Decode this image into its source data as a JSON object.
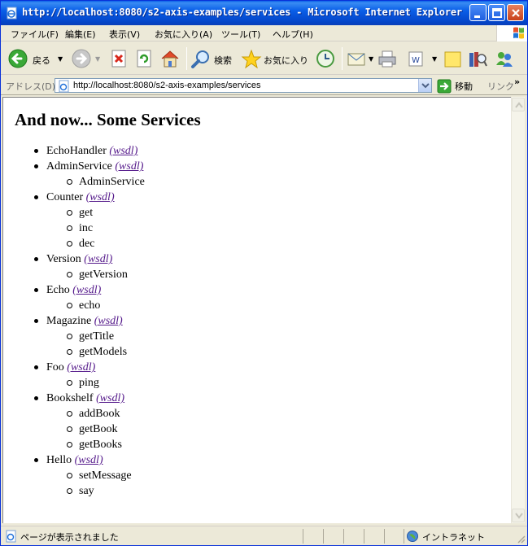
{
  "window": {
    "title": "http://localhost:8080/s2-axis-examples/services - Microsoft Internet Explorer"
  },
  "menu": [
    "ファイル(F)",
    "編集(E)",
    "表示(V)",
    "お気に入り(A)",
    "ツール(T)",
    "ヘルプ(H)"
  ],
  "toolbar": {
    "back_label": "戻る",
    "search_label": "検索",
    "favorites_label": "お気に入り"
  },
  "address": {
    "label": "アドレス(D)",
    "url": "http://localhost:8080/s2-axis-examples/services",
    "go_label": "移動",
    "links_label": "リンク"
  },
  "page": {
    "title": "And now... Some Services",
    "services": [
      {
        "name": "EchoHandler",
        "link": "(wsdl)",
        "ops": []
      },
      {
        "name": "AdminService",
        "link": "(wsdl)",
        "ops": [
          "AdminService"
        ]
      },
      {
        "name": "Counter",
        "link": "(wsdl)",
        "ops": [
          "get",
          "inc",
          "dec"
        ]
      },
      {
        "name": "Version",
        "link": "(wsdl)",
        "ops": [
          "getVersion"
        ]
      },
      {
        "name": "Echo",
        "link": "(wsdl)",
        "ops": [
          "echo"
        ]
      },
      {
        "name": "Magazine",
        "link": "(wsdl)",
        "ops": [
          "getTitle",
          "getModels"
        ]
      },
      {
        "name": "Foo",
        "link": "(wsdl)",
        "ops": [
          "ping"
        ]
      },
      {
        "name": "Bookshelf",
        "link": "(wsdl)",
        "ops": [
          "addBook",
          "getBook",
          "getBooks"
        ]
      },
      {
        "name": "Hello",
        "link": "(wsdl)",
        "ops": [
          "setMessage",
          "say"
        ]
      }
    ]
  },
  "status": {
    "text": "ページが表示されました",
    "zone": "イントラネット"
  },
  "colors": {
    "titlebar": "#0a5fe8",
    "visited_link": "#551a8b",
    "chrome": "#ece9d8"
  }
}
